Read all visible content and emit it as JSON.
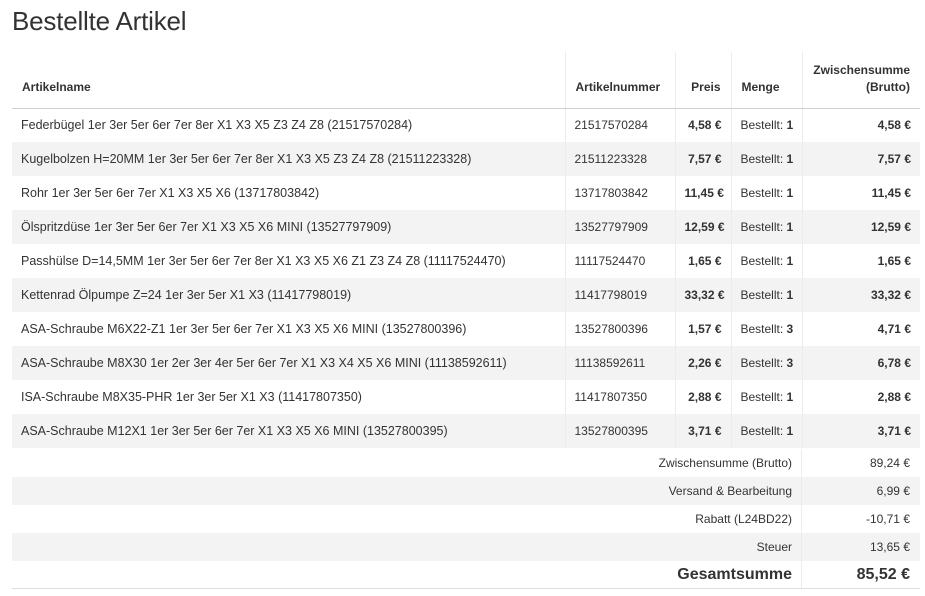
{
  "page": {
    "title": "Bestellte Artikel"
  },
  "table": {
    "headers": {
      "name": "Artikelname",
      "sku": "Artikelnummer",
      "price": "Preis",
      "qty": "Menge",
      "subtotal_line1": "Zwischensumme",
      "subtotal_line2": "(Brutto)"
    },
    "qty_prefix": "Bestellt:",
    "rows": [
      {
        "name": "Federbügel 1er 3er 5er 6er 7er 8er X1 X3 X5 Z3 Z4 Z8 (21517570284)",
        "sku": "21517570284",
        "price": "4,58 €",
        "qty": "1",
        "subtotal": "4,58 €"
      },
      {
        "name": "Kugelbolzen H=20MM 1er 3er 5er 6er 7er 8er X1 X3 X5 Z3 Z4 Z8 (21511223328)",
        "sku": "21511223328",
        "price": "7,57 €",
        "qty": "1",
        "subtotal": "7,57 €"
      },
      {
        "name": "Rohr 1er 3er 5er 6er 7er X1 X3 X5 X6 (13717803842)",
        "sku": "13717803842",
        "price": "11,45 €",
        "qty": "1",
        "subtotal": "11,45 €"
      },
      {
        "name": "Ölspritzdüse 1er 3er 5er 6er 7er X1 X3 X5 X6 MINI (13527797909)",
        "sku": "13527797909",
        "price": "12,59 €",
        "qty": "1",
        "subtotal": "12,59 €"
      },
      {
        "name": "Passhülse D=14,5MM 1er 3er 5er 6er 7er 8er X1 X3 X5 X6 Z1 Z3 Z4 Z8 (11117524470)",
        "sku": "11117524470",
        "price": "1,65 €",
        "qty": "1",
        "subtotal": "1,65 €"
      },
      {
        "name": "Kettenrad Ölpumpe Z=24 1er 3er 5er X1 X3 (11417798019)",
        "sku": "11417798019",
        "price": "33,32 €",
        "qty": "1",
        "subtotal": "33,32 €"
      },
      {
        "name": "ASA-Schraube M6X22-Z1 1er 3er 5er 6er 7er X1 X3 X5 X6 MINI (13527800396)",
        "sku": "13527800396",
        "price": "1,57 €",
        "qty": "3",
        "subtotal": "4,71 €"
      },
      {
        "name": "ASA-Schraube M8X30 1er 2er 3er 4er 5er 6er 7er X1 X3 X4 X5 X6 MINI (11138592611)",
        "sku": "11138592611",
        "price": "2,26 €",
        "qty": "3",
        "subtotal": "6,78 €"
      },
      {
        "name": "ISA-Schraube M8X35-PHR 1er 3er 5er X1 X3 (11417807350)",
        "sku": "11417807350",
        "price": "2,88 €",
        "qty": "1",
        "subtotal": "2,88 €"
      },
      {
        "name": "ASA-Schraube M12X1 1er 3er 5er 6er 7er X1 X3 X5 X6 MINI (13527800395)",
        "sku": "13527800395",
        "price": "3,71 €",
        "qty": "1",
        "subtotal": "3,71 €"
      }
    ]
  },
  "totals": {
    "subtotal_label": "Zwischensumme (Brutto)",
    "subtotal_value": "89,24 €",
    "shipping_label": "Versand & Bearbeitung",
    "shipping_value": "6,99 €",
    "discount_label": "Rabatt (L24BD22)",
    "discount_value": "-10,71 €",
    "tax_label": "Steuer",
    "tax_value": "13,65 €",
    "grand_label": "Gesamtsumme",
    "grand_value": "85,52 €"
  }
}
